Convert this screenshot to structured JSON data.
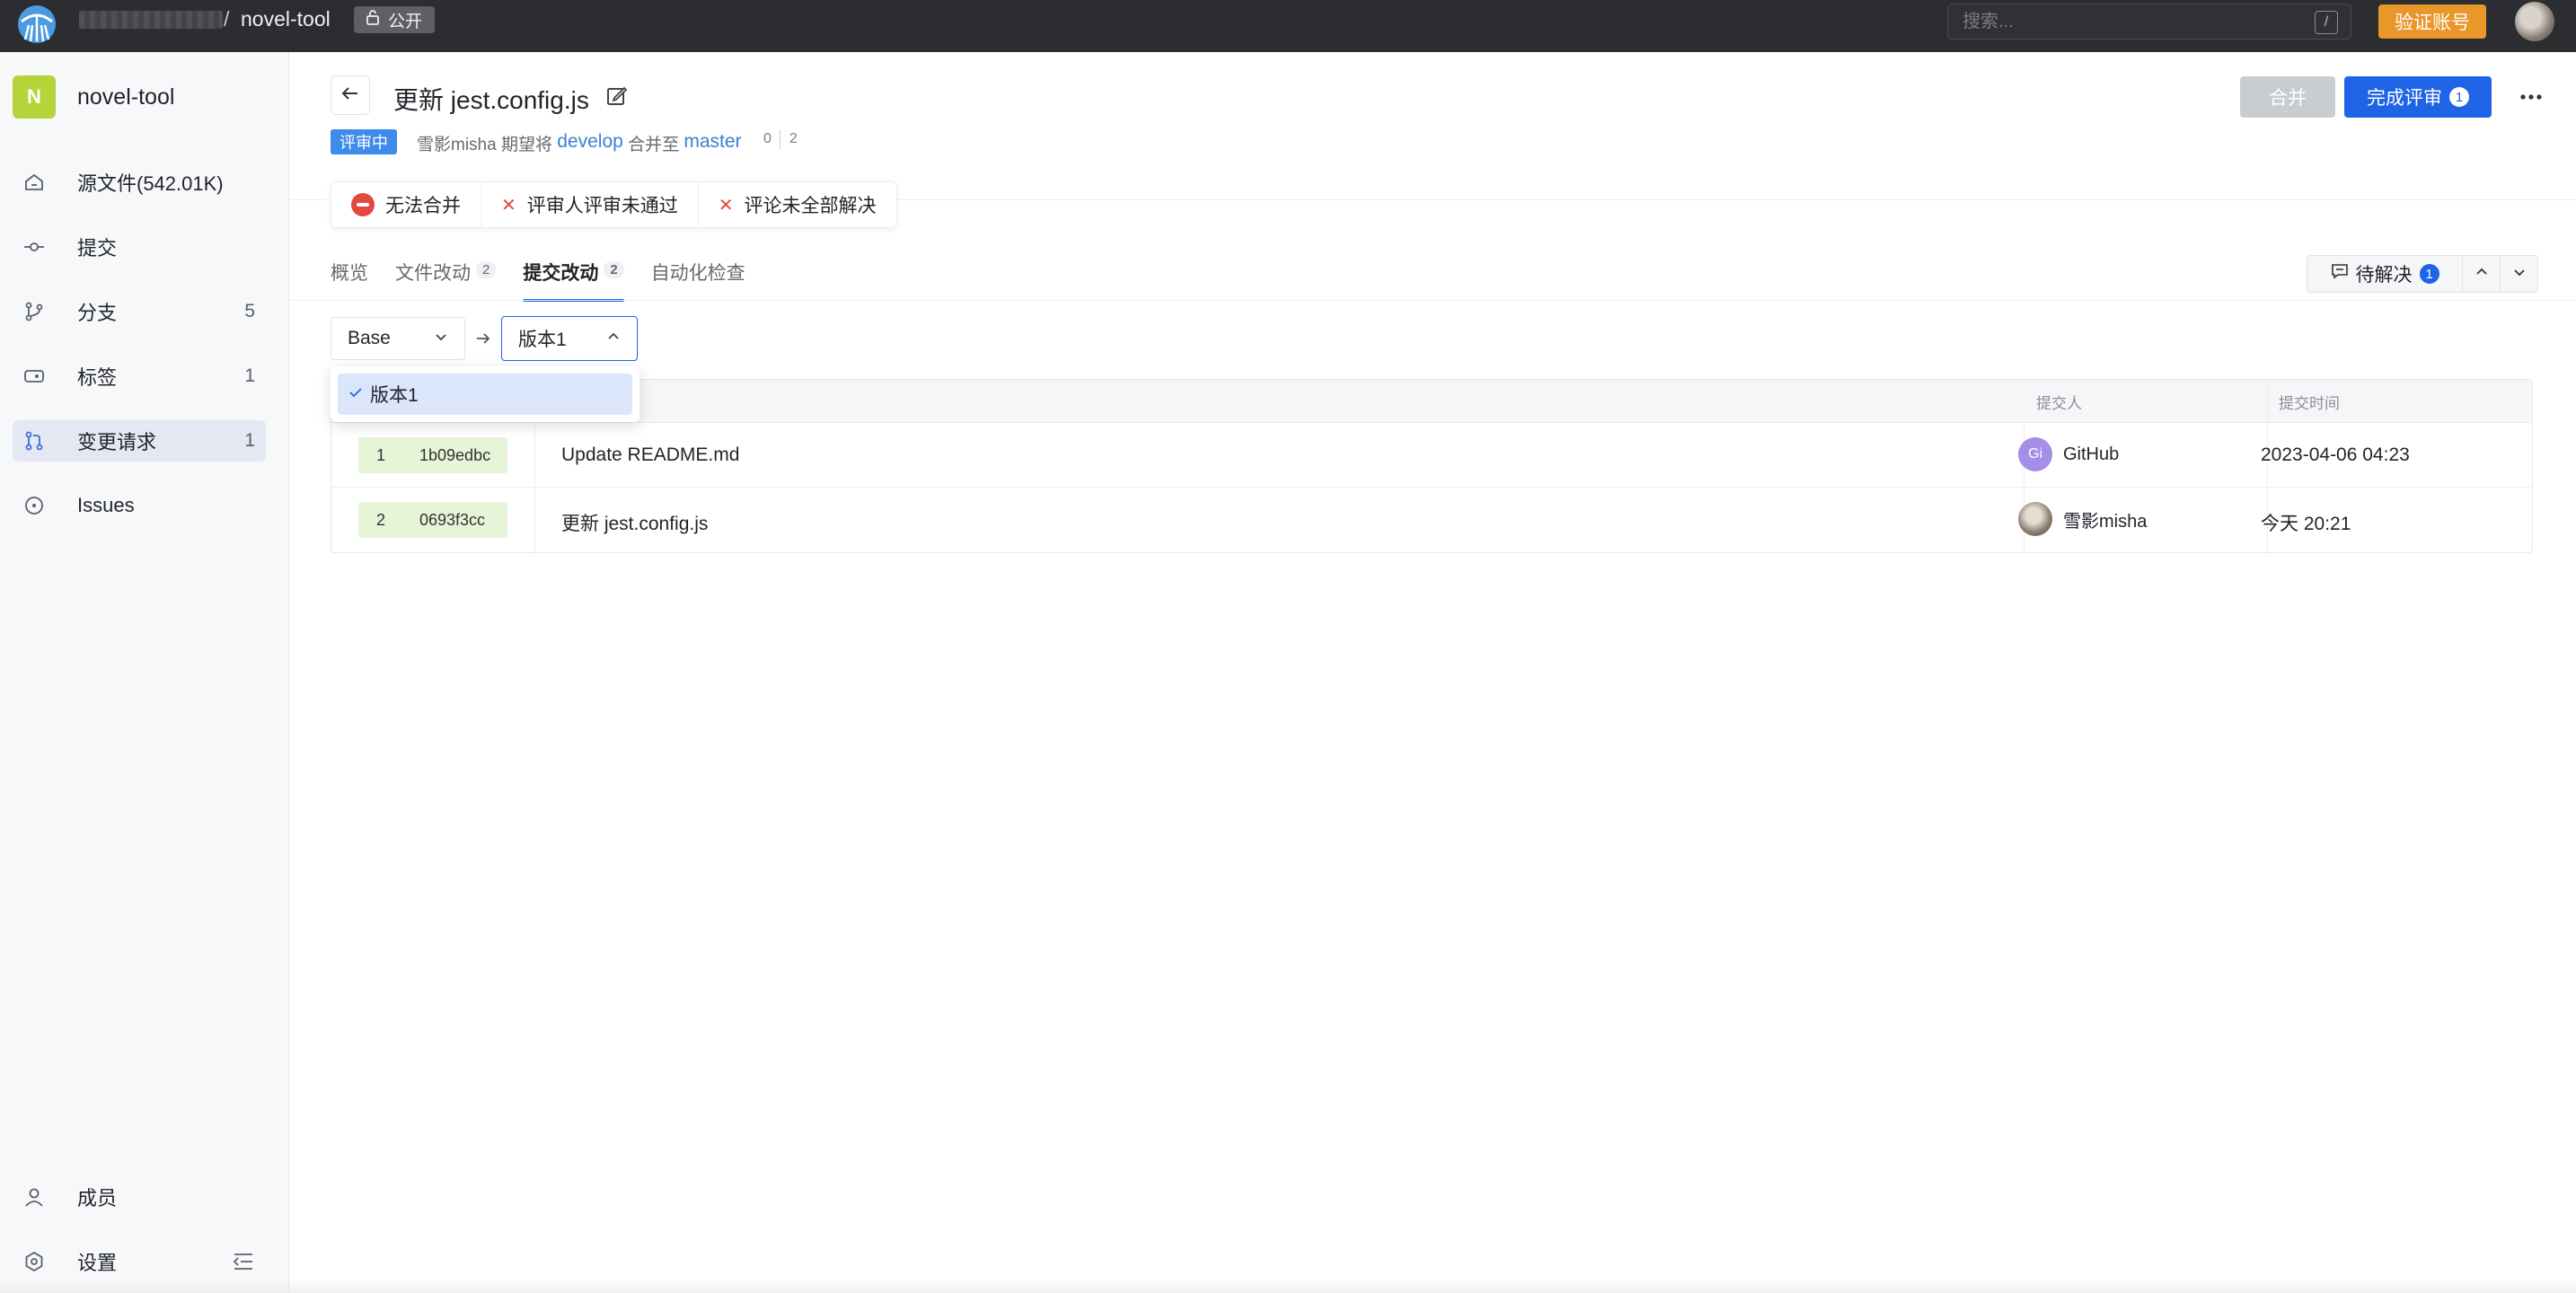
{
  "topbar": {
    "separator": "/",
    "repo": "novel-tool",
    "visibility": "公开",
    "search_placeholder": "搜索...",
    "search_shortcut": "/",
    "verify_label": "验证账号"
  },
  "sidebar": {
    "repo_initial": "N",
    "repo_name": "novel-tool",
    "items": [
      {
        "label": "源文件(542.01K)",
        "icon": "home-icon",
        "count": ""
      },
      {
        "label": "提交",
        "icon": "commit-icon",
        "count": ""
      },
      {
        "label": "分支",
        "icon": "branch-icon",
        "count": "5"
      },
      {
        "label": "标签",
        "icon": "tag-icon",
        "count": "1"
      },
      {
        "label": "变更请求",
        "icon": "pull-request-icon",
        "count": "1"
      },
      {
        "label": "Issues",
        "icon": "issue-icon",
        "count": ""
      }
    ],
    "bottom": [
      {
        "label": "成员",
        "icon": "user-icon"
      },
      {
        "label": "设置",
        "icon": "settings-icon"
      }
    ]
  },
  "pr": {
    "title": "更新 jest.config.js",
    "status": "评审中",
    "author": "雪影misha",
    "meta_wants": " 期望将 ",
    "source_branch": "develop",
    "meta_merge_to": " 合并至 ",
    "target_branch": "master",
    "deletions": "0",
    "additions": "2",
    "merge_label": "合并",
    "finish_review_label": "完成评审",
    "finish_review_count": "1"
  },
  "checks": [
    {
      "label": "无法合并",
      "type": "blocked"
    },
    {
      "label": "评审人评审未通过",
      "type": "fail"
    },
    {
      "label": "评论未全部解决",
      "type": "fail"
    }
  ],
  "tabs": [
    {
      "label": "概览",
      "count": ""
    },
    {
      "label": "文件改动",
      "count": "2"
    },
    {
      "label": "提交改动",
      "count": "2"
    },
    {
      "label": "自动化检查",
      "count": ""
    }
  ],
  "pending": {
    "label": "待解决",
    "count": "1"
  },
  "versions": {
    "base": "Base",
    "current": "版本1",
    "options": [
      "版本1"
    ]
  },
  "table": {
    "headers": {
      "author": "提交人",
      "time": "提交时间"
    },
    "rows": [
      {
        "index": "1",
        "sha": "1b09edbc",
        "message": "Update README.md",
        "author": "GitHub",
        "avatar": "Gi",
        "time": "2023-04-06 04:23"
      },
      {
        "index": "2",
        "sha": "0693f3cc",
        "message": "更新 jest.config.js",
        "author": "雪影misha",
        "avatar": "",
        "time": "今天 20:21"
      }
    ]
  },
  "colors": {
    "accent": "#1f64e6",
    "warning": "#e9962b",
    "danger": "#e2483d",
    "status_badge": "#3d8bea",
    "commit_chip": "#e6f4d7"
  }
}
